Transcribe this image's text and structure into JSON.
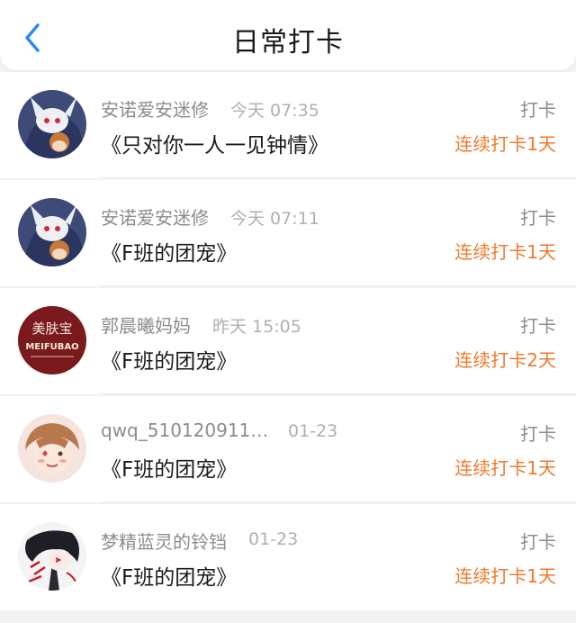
{
  "header": {
    "title": "日常打卡",
    "back_icon": "chevron-left-icon",
    "accent_color": "#2a8cf0"
  },
  "records": [
    {
      "user": "安诺爱安迷修",
      "time": "今天 07:35",
      "book": "《只对你一人一见钟情》",
      "action": "打卡",
      "streak": "连续打卡1天"
    },
    {
      "user": "安诺爱安迷修",
      "time": "今天 07:11",
      "book": "《F班的团宠》",
      "action": "打卡",
      "streak": "连续打卡1天"
    },
    {
      "user": "郭晨曦妈妈",
      "time": "昨天 15:05",
      "book": "《F班的团宠》",
      "action": "打卡",
      "streak": "连续打卡2天"
    },
    {
      "user": "qwq_510120911…",
      "time": "01-23",
      "book": "《F班的团宠》",
      "action": "打卡",
      "streak": "连续打卡1天"
    },
    {
      "user": "梦精蓝灵的铃铛",
      "time": "01-23",
      "book": "《F班的团宠》",
      "action": "打卡",
      "streak": "连续打卡1天"
    }
  ],
  "avatar_logo_text": {
    "line1": "美肤宝",
    "line2": "MEIFUBAO"
  },
  "colors": {
    "streak": "#f07a2a",
    "muted_text": "#8c8c8c",
    "time_text": "#b0b0b0",
    "primary_text": "#1a1a1a"
  }
}
